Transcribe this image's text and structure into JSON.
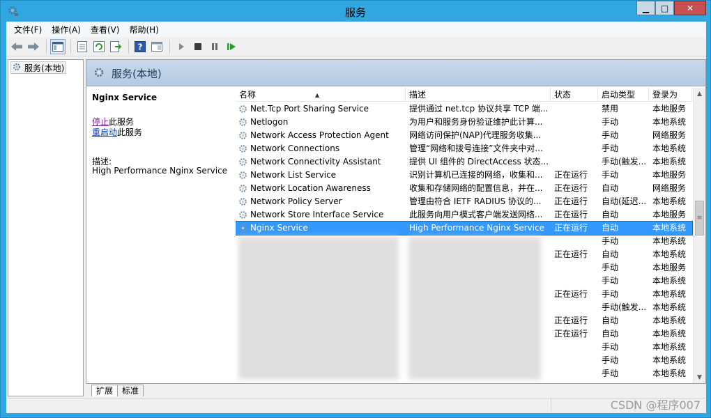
{
  "window": {
    "title": "服务",
    "minimize": "▁",
    "maximize": "□",
    "close": "✕"
  },
  "menu": [
    "文件(F)",
    "操作(A)",
    "查看(V)",
    "帮助(H)"
  ],
  "toolbar_icons": [
    "back-arrow-icon",
    "forward-arrow-icon",
    "console-tree-icon",
    "properties-icon",
    "refresh-icon",
    "export-list-icon",
    "help-icon",
    "show-pane-icon",
    "start-service-icon",
    "stop-service-icon",
    "pause-service-icon",
    "restart-service-icon"
  ],
  "tree": {
    "root_label": "服务(本地)"
  },
  "header": {
    "title": "服务(本地)"
  },
  "detail": {
    "service_name": "Nginx Service",
    "stop_link": "停止",
    "stop_suffix": "此服务",
    "restart_link": "重启动",
    "restart_suffix": "此服务",
    "description_label": "描述:",
    "description": "High Performance Nginx Service"
  },
  "list": {
    "columns": [
      "名称",
      "描述",
      "状态",
      "启动类型",
      "登录为"
    ],
    "sort_indicator": "▲",
    "rows": [
      {
        "name": "Net.Tcp Port Sharing Service",
        "desc": "提供通过 net.tcp 协议共享 TCP 端...",
        "status": "",
        "startup": "禁用",
        "logon": "本地服务"
      },
      {
        "name": "Netlogon",
        "desc": "为用户和服务身份验证维护此计算...",
        "status": "",
        "startup": "手动",
        "logon": "本地系统"
      },
      {
        "name": "Network Access Protection Agent",
        "desc": "网络访问保护(NAP)代理服务收集...",
        "status": "",
        "startup": "手动",
        "logon": "网络服务"
      },
      {
        "name": "Network Connections",
        "desc": "管理“网络和拨号连接”文件夹中对...",
        "status": "",
        "startup": "手动",
        "logon": "本地系统"
      },
      {
        "name": "Network Connectivity Assistant",
        "desc": "提供 UI 组件的 DirectAccess 状态...",
        "status": "",
        "startup": "手动(触发...",
        "logon": "本地系统"
      },
      {
        "name": "Network List Service",
        "desc": "识别计算机已连接的网络，收集和...",
        "status": "正在运行",
        "startup": "手动",
        "logon": "本地服务"
      },
      {
        "name": "Network Location Awareness",
        "desc": "收集和存储网络的配置信息，并在...",
        "status": "正在运行",
        "startup": "自动",
        "logon": "网络服务"
      },
      {
        "name": "Network Policy Server",
        "desc": "管理由符合 IETF RADIUS 协议的...",
        "status": "正在运行",
        "startup": "自动(延迟...",
        "logon": "本地系统"
      },
      {
        "name": "Network Store Interface Service",
        "desc": "此服务向用户模式客户端发送网络...",
        "status": "正在运行",
        "startup": "自动",
        "logon": "本地服务"
      },
      {
        "name": "Nginx Service",
        "desc": "High Performance Nginx Service",
        "status": "正在运行",
        "startup": "自动",
        "logon": "本地系统",
        "selected": true
      },
      {
        "name": "",
        "desc": "",
        "status": "",
        "startup": "手动",
        "logon": "本地系统",
        "blurred": true
      },
      {
        "name": "",
        "desc": "",
        "status": "正在运行",
        "startup": "自动",
        "logon": "本地系统",
        "blurred": true
      },
      {
        "name": "",
        "desc": "",
        "status": "",
        "startup": "手动",
        "logon": "本地服务",
        "blurred": true
      },
      {
        "name": "",
        "desc": "",
        "status": "",
        "startup": "手动",
        "logon": "本地系统",
        "blurred": true
      },
      {
        "name": "",
        "desc": "",
        "status": "正在运行",
        "startup": "手动",
        "logon": "本地系统",
        "blurred": true
      },
      {
        "name": "",
        "desc": "",
        "status": "",
        "startup": "手动(触发...",
        "logon": "本地系统",
        "blurred": true
      },
      {
        "name": "",
        "desc": "",
        "status": "正在运行",
        "startup": "自动",
        "logon": "本地系统",
        "blurred": true
      },
      {
        "name": "",
        "desc": "",
        "status": "正在运行",
        "startup": "自动",
        "logon": "本地系统",
        "blurred": true
      },
      {
        "name": "",
        "desc": "",
        "status": "",
        "startup": "手动",
        "logon": "本地系统",
        "blurred": true
      },
      {
        "name": "",
        "desc": "",
        "status": "",
        "startup": "手动",
        "logon": "本地系统",
        "blurred": true
      },
      {
        "name": "",
        "desc": "",
        "status": "",
        "startup": "手动",
        "logon": "本地系统",
        "blurred": true
      }
    ]
  },
  "tabs": [
    "扩展",
    "标准"
  ],
  "watermark": "CSDN @程序007"
}
